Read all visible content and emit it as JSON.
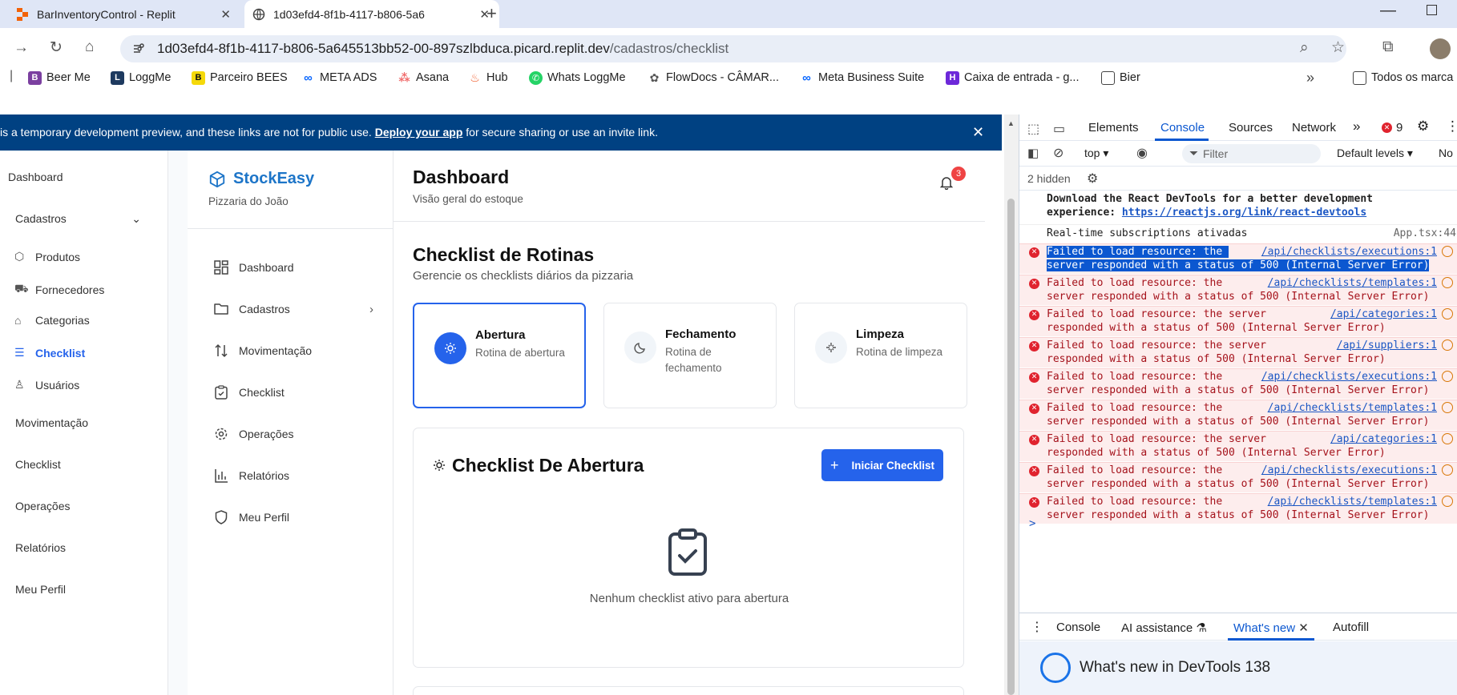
{
  "browser": {
    "tabs": [
      {
        "title": "BarInventoryControl - Replit",
        "active": false
      },
      {
        "title": "1d03efd4-8f1b-4117-b806-5a6",
        "active": true
      }
    ],
    "url_host": "1d03efd4-8f1b-4117-b806-5a645513bb52-00-897szlbduca.picard.replit.dev",
    "url_path": "/cadastros/checklist",
    "bookmarks": [
      "Beer Me",
      "LoggMe",
      "Parceiro BEES",
      "META ADS",
      "Asana",
      "Hub",
      "Whats LoggMe",
      "FlowDocs - CÂMAR...",
      "Meta Business Suite",
      "Caixa de entrada - g...",
      "Bier",
      "Todos os marca"
    ]
  },
  "banner": {
    "prefix": "is a temporary development preview, and these links are not for public use.",
    "link": "Deploy your app",
    "suffix": "for secure sharing or use an invite link."
  },
  "outer_sidebar": {
    "items": [
      "Dashboard",
      "Cadastros",
      "Produtos",
      "Fornecedores",
      "Categorias",
      "Checklist",
      "Usuários",
      "Movimentação",
      "Checklist",
      "Operações",
      "Relatórios",
      "Meu Perfil"
    ]
  },
  "app": {
    "brand": "StockEasy",
    "brand_sub": "Pizzaria do João",
    "brand_color": "#1d75c8",
    "nav": [
      "Dashboard",
      "Cadastros",
      "Movimentação",
      "Checklist",
      "Operações",
      "Relatórios",
      "Meu Perfil"
    ],
    "header_title": "Dashboard",
    "header_sub": "Visão geral do estoque",
    "notifications": "3",
    "section_title": "Checklist de Rotinas",
    "section_sub": "Gerencie os checklists diários da pizzaria",
    "routines": [
      {
        "title": "Abertura",
        "desc": "Rotina de abertura",
        "icon": "sun-icon"
      },
      {
        "title": "Fechamento",
        "desc": "Rotina de fechamento",
        "icon": "moon-icon"
      },
      {
        "title": "Limpeza",
        "desc": "Rotina de limpeza",
        "icon": "sparkle-icon"
      }
    ],
    "checklist_title": "Checklist De Abertura",
    "start_button": "Iniciar Checklist",
    "empty_text": "Nenhum checklist ativo para abertura",
    "accent": "#2563eb"
  },
  "devtools": {
    "tabs": [
      "Elements",
      "Console",
      "Sources",
      "Network"
    ],
    "error_count": "9",
    "context": "top",
    "filter_placeholder": "Filter",
    "levels": "Default levels",
    "levels_tail": "No",
    "hidden": "2 hidden",
    "logs": [
      {
        "line1": "Download the React DevTools for a better development",
        "line2_prefix": "experience: ",
        "link": "https://reactjs.org/link/react-devtools"
      },
      {
        "text": "Real-time subscriptions ativadas",
        "source": "App.tsx:44"
      }
    ],
    "errors": [
      {
        "line1": "Failed to load resource: the ",
        "url": "/api/checklists/executions:1",
        "line2": "server responded with a status of 500 (Internal Server Error)"
      },
      {
        "line1": "Failed to load resource: the ",
        "url": "/api/checklists/templates:1",
        "line2": "server responded with a status of 500 (Internal Server Error)"
      },
      {
        "line1": "Failed to load resource: the server",
        "url": "/api/categories:1",
        "line2": "responded with a status of 500 (Internal Server Error)"
      },
      {
        "line1": "Failed to load resource: the server",
        "url": "/api/suppliers:1",
        "line2": "responded with a status of 500 (Internal Server Error)"
      },
      {
        "line1": "Failed to load resource: the ",
        "url": "/api/checklists/executions:1",
        "line2": "server responded with a status of 500 (Internal Server Error)"
      },
      {
        "line1": "Failed to load resource: the ",
        "url": "/api/checklists/templates:1",
        "line2": "server responded with a status of 500 (Internal Server Error)"
      },
      {
        "line1": "Failed to load resource: the server",
        "url": "/api/categories:1",
        "line2": "responded with a status of 500 (Internal Server Error)"
      },
      {
        "line1": "Failed to load resource: the ",
        "url": "/api/checklists/executions:1",
        "line2": "server responded with a status of 500 (Internal Server Error)"
      },
      {
        "line1": "Failed to load resource: the ",
        "url": "/api/checklists/templates:1",
        "line2": "server responded with a status of 500 (Internal Server Error)"
      }
    ],
    "prompt": ">",
    "drawer_tabs": [
      "Console",
      "AI assistance",
      "What's new",
      "Autofill"
    ],
    "whats_new_title": "What's new in DevTools 138"
  }
}
